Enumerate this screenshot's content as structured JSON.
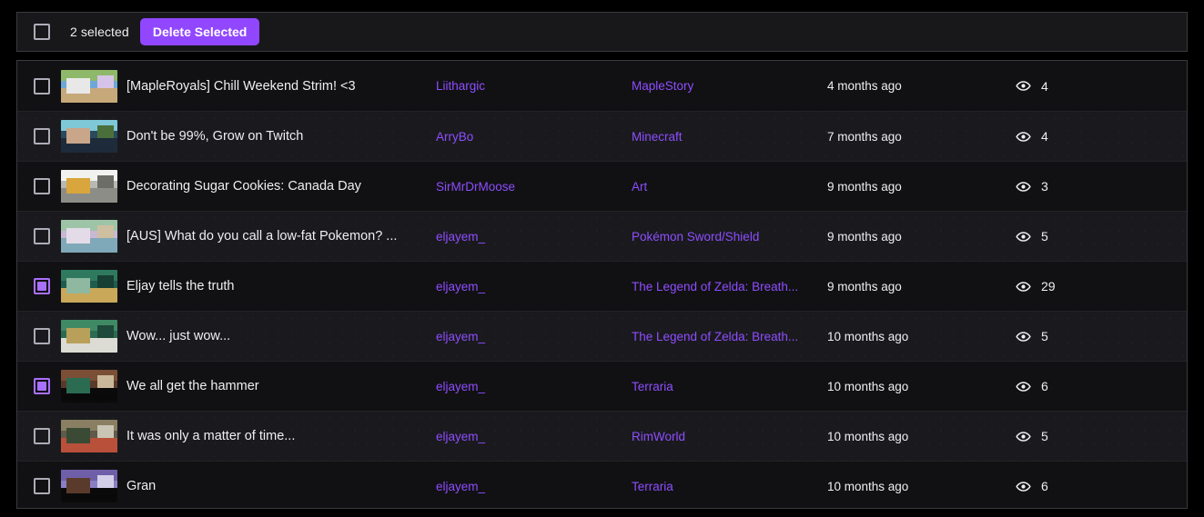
{
  "toolbar": {
    "select_all_checked": false,
    "selected_label": "2 selected",
    "delete_label": "Delete Selected",
    "accent_color": "#9147ff"
  },
  "theme": {
    "page_background": "#000000",
    "panel_background": "#0e0e10",
    "panel_border": "#3a3a3d",
    "row_odd": "#111113",
    "row_even": "#1a1a1e",
    "text_primary": "#efeff1",
    "link_purple": "#8e4dff",
    "checkbox_border": "#adadb8",
    "checkbox_checked": "#a970ff"
  },
  "icons": {
    "views": "eye-icon"
  },
  "rows": [
    {
      "checked": false,
      "title": "[MapleRoyals] Chill Weekend Strim! <3",
      "user": "Liithargic",
      "game": "MapleStory",
      "date": "4 months ago",
      "views": "4",
      "thumb": [
        "#6ea8d8",
        "#8fb96a",
        "#e8e8e8",
        "#c7a87a",
        "#d6c4e8"
      ]
    },
    {
      "checked": false,
      "title": "Don't be 99%, Grow on Twitch",
      "user": "ArryBo",
      "game": "Minecraft",
      "date": "7 months ago",
      "views": "4",
      "thumb": [
        "#2a4a5e",
        "#7ec8d8",
        "#c9a58a",
        "#1d2b3a",
        "#4a6f3a"
      ]
    },
    {
      "checked": false,
      "title": "Decorating Sugar Cookies: Canada Day",
      "user": "SirMrDrMoose",
      "game": "Art",
      "date": "9 months ago",
      "views": "3",
      "thumb": [
        "#b9b9b4",
        "#f2f2f0",
        "#d8a63c",
        "#8d8d88",
        "#6d6d68"
      ]
    },
    {
      "checked": false,
      "title": "[AUS] What do you call a low-fat Pokemon? ...",
      "user": "eljayem_",
      "game": "Pokémon Sword/Shield",
      "date": "9 months ago",
      "views": "5",
      "thumb": [
        "#c9b7d4",
        "#9ec4a8",
        "#e4dbe8",
        "#7fa8b8",
        "#cdbfa0"
      ]
    },
    {
      "checked": true,
      "title": "Eljay tells the truth",
      "user": "eljayem_",
      "game": "The Legend of Zelda: Breath...",
      "date": "9 months ago",
      "views": "29",
      "thumb": [
        "#1f5c4d",
        "#2f7a5e",
        "#8fb8a0",
        "#c9a85a",
        "#173f34"
      ]
    },
    {
      "checked": false,
      "title": "Wow... just wow...",
      "user": "eljayem_",
      "game": "The Legend of Zelda: Breath...",
      "date": "10 months ago",
      "views": "5",
      "thumb": [
        "#2a6b52",
        "#3f8a64",
        "#b9a05a",
        "#dcdcd4",
        "#1d4a3a"
      ]
    },
    {
      "checked": true,
      "title": "We all get the hammer",
      "user": "eljayem_",
      "game": "Terraria",
      "date": "10 months ago",
      "views": "6",
      "thumb": [
        "#5a3a2a",
        "#7a4f35",
        "#2a6b52",
        "#0a0a0a",
        "#c9b89a"
      ]
    },
    {
      "checked": false,
      "title": "It was only a matter of time...",
      "user": "eljayem_",
      "game": "RimWorld",
      "date": "10 months ago",
      "views": "5",
      "thumb": [
        "#5f5a4a",
        "#8a7f62",
        "#3a4a35",
        "#b9503a",
        "#c9c4b4"
      ]
    },
    {
      "checked": false,
      "title": "Gran",
      "user": "eljayem_",
      "game": "Terraria",
      "date": "10 months ago",
      "views": "6",
      "thumb": [
        "#8a7fc4",
        "#6f5fa8",
        "#5a3a2a",
        "#0a0a0a",
        "#d4cfe8"
      ]
    }
  ]
}
